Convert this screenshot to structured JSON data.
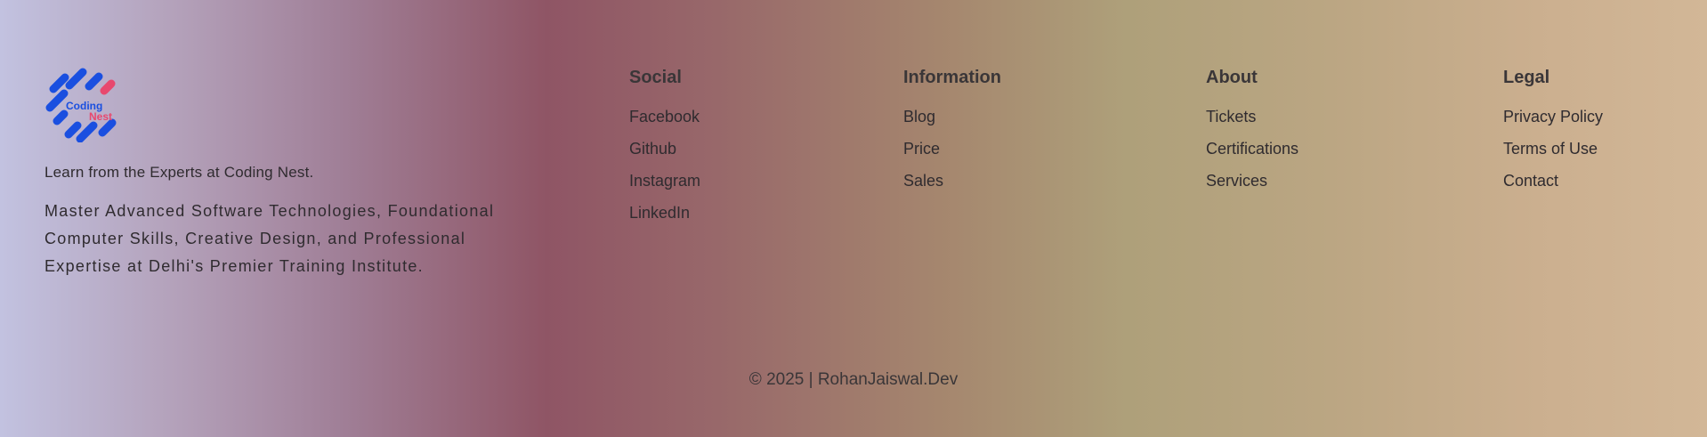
{
  "brand": {
    "logo_text_top": "Coding",
    "logo_text_bottom": "Nest",
    "logo_colors": {
      "primary": "#1a4fe0",
      "accent": "#e8486e"
    },
    "tagline": "Learn from the Experts at Coding Nest.",
    "description": "Master Advanced Software Technologies, Foundational Computer Skills, Creative Design, and Professional Expertise at Delhi's Premier Training Institute."
  },
  "columns": {
    "social": {
      "heading": "Social",
      "links": [
        "Facebook",
        "Github",
        "Instagram",
        "LinkedIn"
      ]
    },
    "information": {
      "heading": "Information",
      "links": [
        "Blog",
        "Price",
        "Sales"
      ]
    },
    "about": {
      "heading": "About",
      "links": [
        "Tickets",
        "Certifications",
        "Services"
      ]
    },
    "legal": {
      "heading": "Legal",
      "links": [
        "Privacy Policy",
        "Terms of Use",
        "Contact"
      ]
    }
  },
  "copyright": "© 2025 | RohanJaiswal.Dev"
}
